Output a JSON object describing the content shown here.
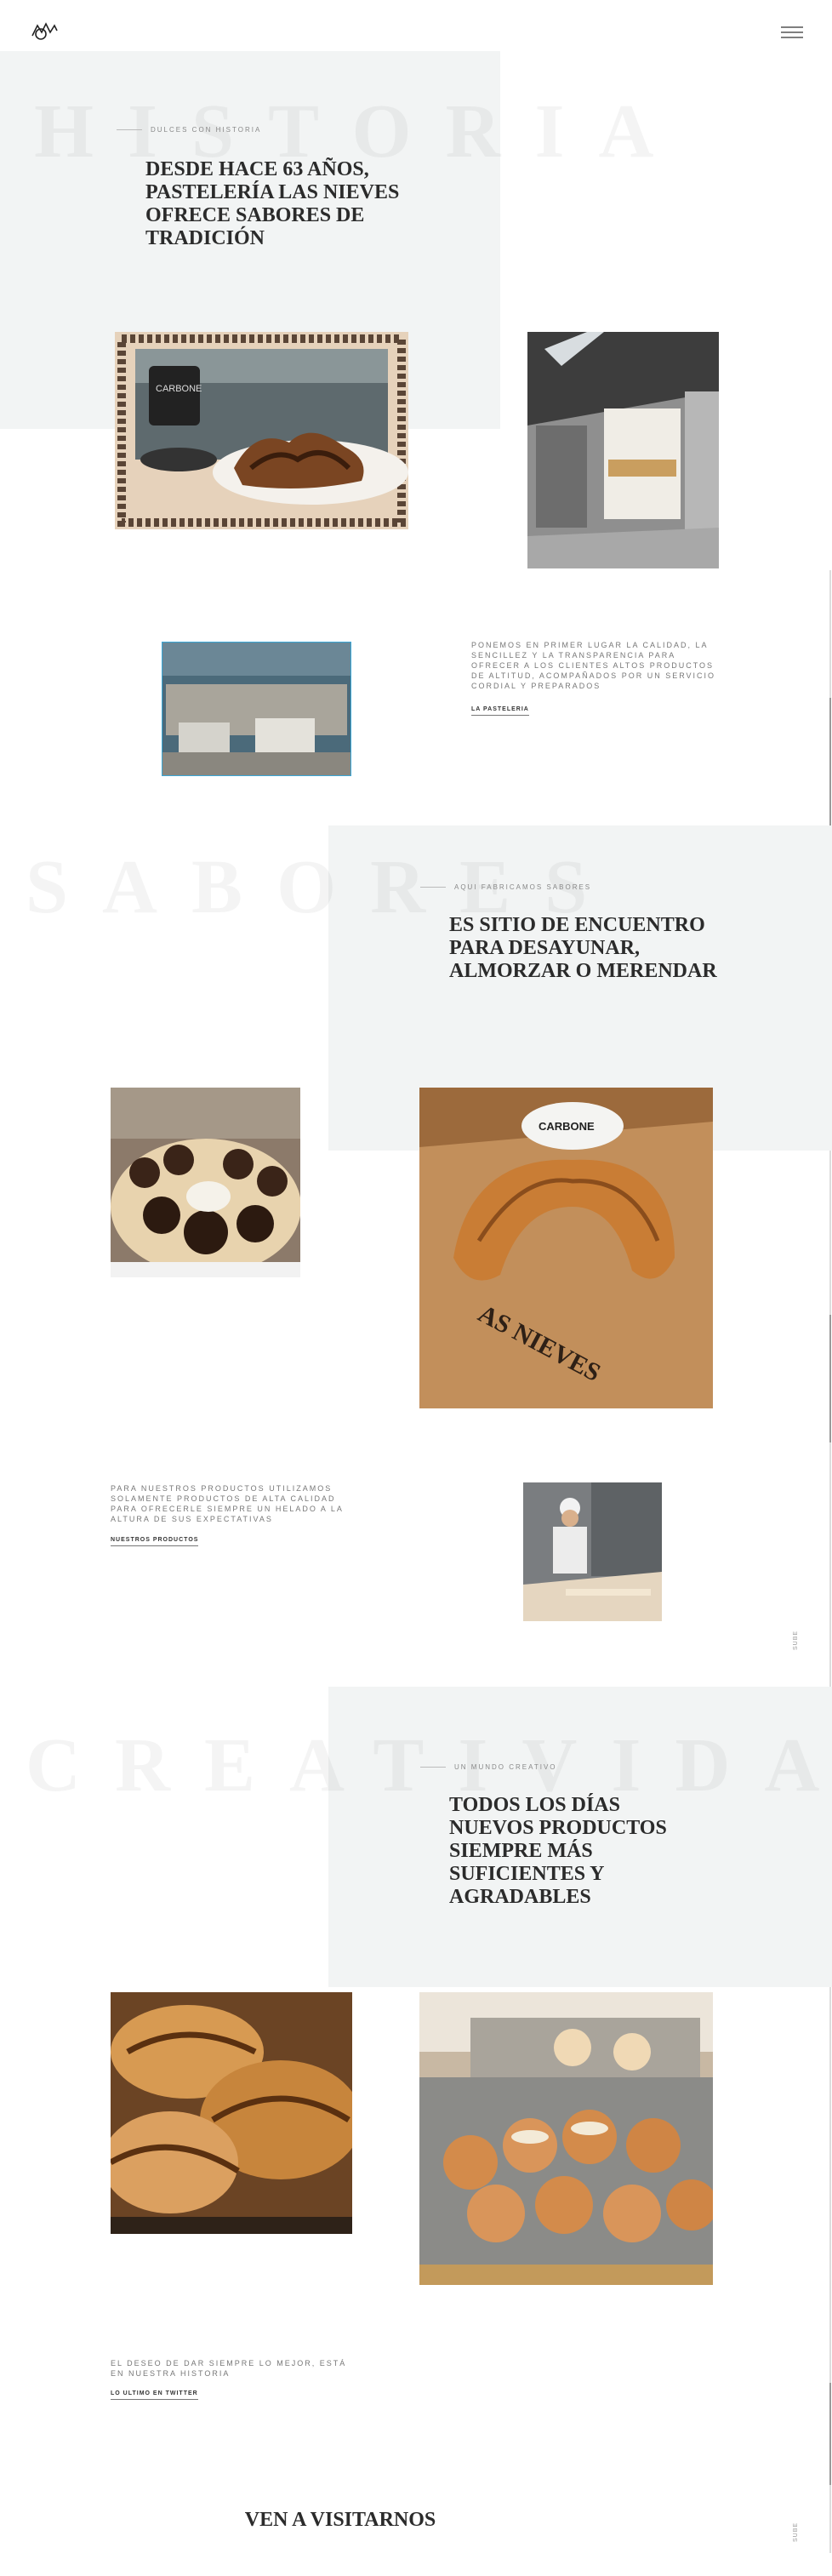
{
  "header": {
    "logo_icon": "pasteleria-logo-icon",
    "menu_icon": "hamburger-menu-icon"
  },
  "section_historia": {
    "bg_word": "HISTORIA",
    "kicker": "DULCES CON HISTORIA",
    "headline": "DESDE HACE 63 AÑOS, PASTELERÍA LAS NIEVES OFRECE SABORES DE TRADICIÓN",
    "body": "PONEMOS EN PRIMER LUGAR LA CALIDAD, LA SENCILLEZ Y LA TRANSPARENCIA PARA OFRECER A LOS CLIENTES ALTOS PRODUCTOS DE ALTITUD, ACOMPAÑADOS POR UN SERVICIO CORDIAL Y PREPARADOS",
    "link": "LA PASTELERIA"
  },
  "section_sabores": {
    "bg_word": "SABORES",
    "kicker": "AQUI FABRICAMOS SABORES",
    "headline": "ES SITIO DE ENCUENTRO PARA DESAYUNAR, ALMORZAR O MERENDAR",
    "body": "PARA NUESTROS PRODUCTOS UTILIZAMOS SOLAMENTE PRODUCTOS DE ALTA CALIDAD PARA OFRECERLE SIEMPRE UN HELADO A LA ALTURA DE SUS EXPECTATIVAS",
    "link": "NUESTROS PRODUCTOS",
    "side_label": "SUBE"
  },
  "section_creatividad": {
    "bg_word": "CREATIVIDAD",
    "kicker": "UN MUNDO CREATIVO",
    "headline": "TODOS LOS DÍAS NUEVOS PRODUCTOS SIEMPRE MÁS SUFICIENTES Y AGRADABLES",
    "body": "EL DESEO DE DAR SIEMPRE LO MEJOR, ESTÁ EN NUESTRA HISTORIA",
    "link": "LO ULTIMO EN TWITTER",
    "side_label": "SUBE"
  },
  "footer": {
    "title": "VEN A VISITARNOS"
  },
  "colors": {
    "panel": "#f2f4f4",
    "text_dark": "#2b2b2b",
    "text_muted": "#777777"
  }
}
